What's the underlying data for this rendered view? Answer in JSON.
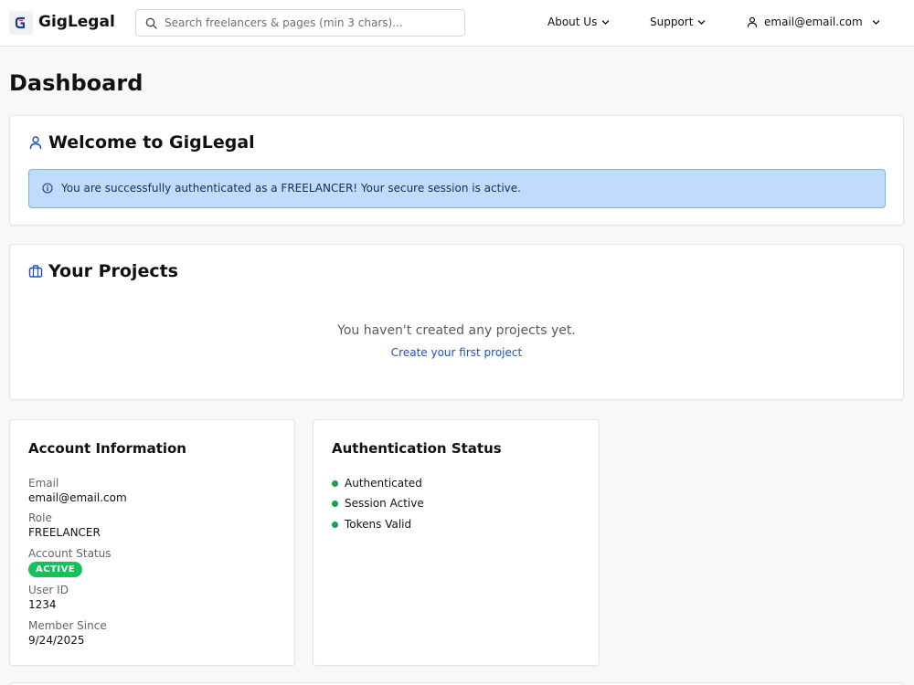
{
  "header": {
    "brand": "GigLegal",
    "search_placeholder": "Search freelancers & pages (min 3 chars)...",
    "nav": {
      "about": "About Us",
      "support": "Support",
      "user_email": "email@email.com"
    }
  },
  "page": {
    "title": "Dashboard"
  },
  "welcome": {
    "heading": "Welcome to GigLegal",
    "alert_text": "You are successfully authenticated as a FREELANCER! Your secure session is active."
  },
  "projects": {
    "heading": "Your Projects",
    "empty_text": "You haven't created any projects yet.",
    "create_link": "Create your first project"
  },
  "account": {
    "heading": "Account Information",
    "email_label": "Email",
    "email_value": "email@email.com",
    "role_label": "Role",
    "role_value": "FREELANCER",
    "status_label": "Account Status",
    "status_value": "ACTIVE",
    "userid_label": "User ID",
    "userid_value": "1234",
    "member_label": "Member Since",
    "member_value": "9/24/2025"
  },
  "auth": {
    "heading": "Authentication Status",
    "items": [
      "Authenticated",
      "Session Active",
      "Tokens Valid"
    ]
  },
  "colors": {
    "accent": "#1d4ed8",
    "alert_bg": "#bfdbfe",
    "badge_green": "#16c15a",
    "dot_green": "#16a34a"
  }
}
